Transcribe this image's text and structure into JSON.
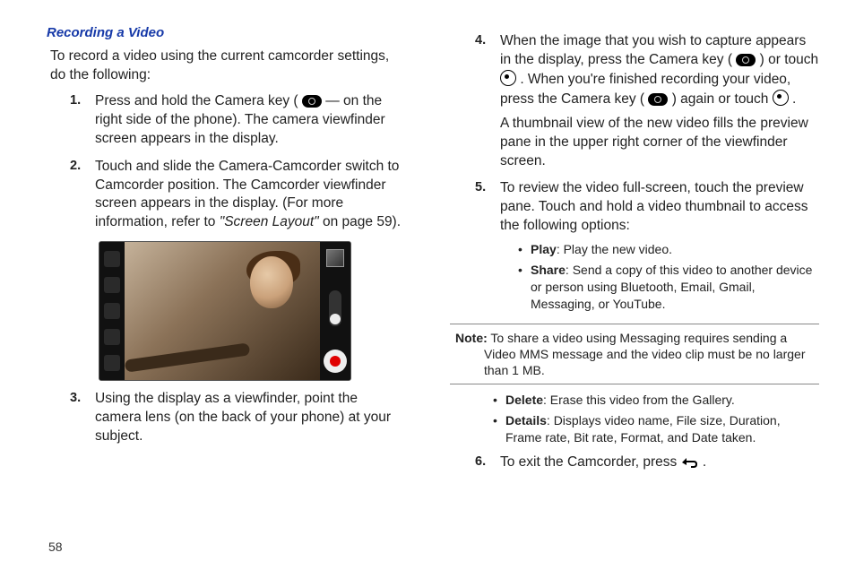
{
  "heading": "Recording a Video",
  "intro": "To record a video using the current camcorder settings, do the following:",
  "steps": {
    "s1": {
      "num": "1.",
      "text_a": "Press and hold the Camera key (",
      "text_b": " — on the right side of the phone). The camera viewfinder screen appears in the display."
    },
    "s2": {
      "num": "2.",
      "text_a": "Touch and slide the Camera-Camcorder switch to Camcorder position. The Camcorder viewfinder screen appears in the display. (For more information, refer to ",
      "italic": "\"Screen Layout\"",
      "text_b": " on page 59)."
    },
    "s3": {
      "num": "3.",
      "text": "Using the display as a viewfinder, point the camera lens (on the back of your phone) at your subject."
    },
    "s4": {
      "num": "4.",
      "p1_a": "When the image that you wish to capture appears in the display, press the Camera key (",
      "p1_b": ") or touch ",
      "p1_c": ". When you're finished recording your video, press the Camera key (",
      "p1_d": ") again or touch ",
      "p1_e": ".",
      "p2": "A thumbnail view of the new video fills the preview pane in the upper right corner of the viewfinder screen."
    },
    "s5": {
      "num": "5.",
      "text": "To review the video full-screen, touch the preview pane. Touch and hold a video thumbnail to access the following options:",
      "bullets": {
        "b1_label": "Play",
        "b1_text": ": Play the new video.",
        "b2_label": "Share",
        "b2_text": ": Send a copy of this video to another device or person using Bluetooth, Email, Gmail, Messaging, or YouTube."
      }
    },
    "s6": {
      "num": "6.",
      "text_a": "To exit the Camcorder, press ",
      "text_b": "."
    }
  },
  "note": {
    "label": "Note:",
    "text": "To share a video using Messaging requires sending a Video MMS message and the video clip must be no larger than 1 MB."
  },
  "bullets_after_note": {
    "b3_label": "Delete",
    "b3_text": ": Erase this video from the Gallery.",
    "b4_label": "Details",
    "b4_text": ": Displays video name, File size, Duration, Frame rate, Bit rate, Format, and Date taken."
  },
  "page_number": "58"
}
